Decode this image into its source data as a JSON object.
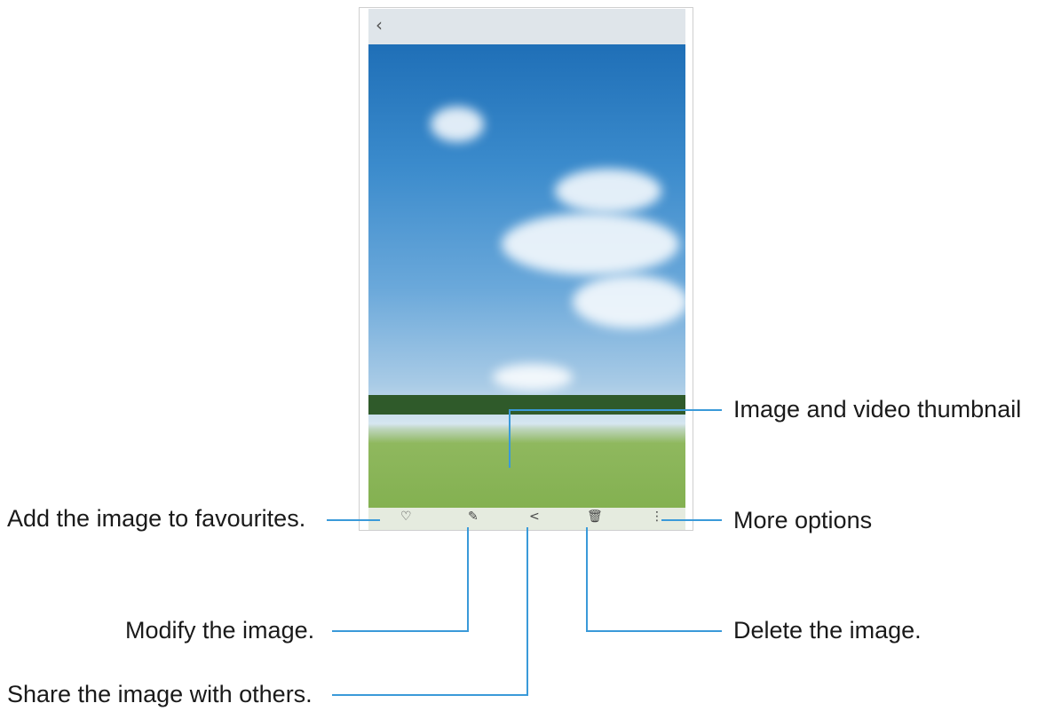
{
  "device": {
    "back_glyph": "‹",
    "actions": {
      "favourite": "♡",
      "edit": "✎",
      "share": "<",
      "delete": "🗑",
      "more": "⋮"
    },
    "thumbnails": [
      "#d7b25a",
      "#cfa49b",
      "#7fb6e3",
      "#e4d7c2",
      "#2a3a6b",
      "#d9a7a0",
      "#c6b3a3",
      "#5b6fa1",
      "#d6dde3",
      "#8fa3b5",
      "#6a9bd0",
      "#4c86b8"
    ]
  },
  "callouts": {
    "thumbnail": "Image and video thumbnail",
    "favourites": "Add the image to favourites.",
    "more": "More options",
    "modify": "Modify the image.",
    "delete": "Delete the image.",
    "share": "Share the image with others."
  }
}
